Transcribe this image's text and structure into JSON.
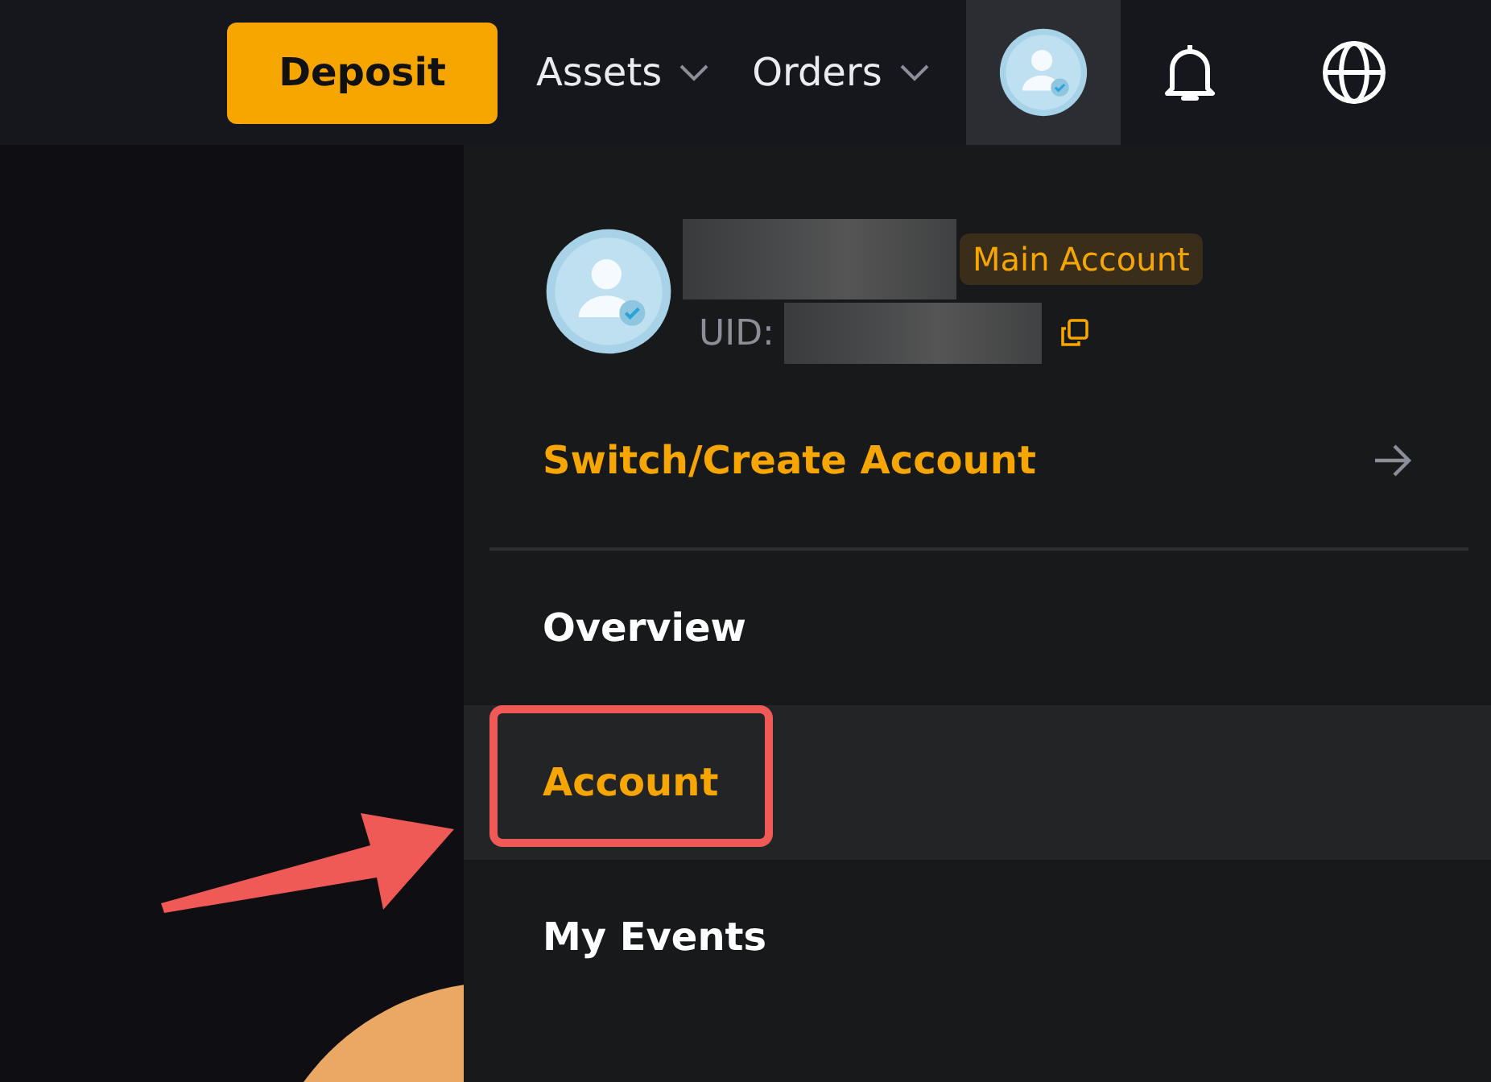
{
  "nav": {
    "deposit": "Deposit",
    "menus": [
      {
        "label": "Assets"
      },
      {
        "label": "Orders"
      }
    ],
    "avatar_active": true
  },
  "profile": {
    "badge": "Main Account",
    "uid_label": "UID:"
  },
  "switch_account": "Switch/Create Account",
  "menu": [
    {
      "label": "Overview",
      "selected": false
    },
    {
      "label": "Account",
      "selected": true
    },
    {
      "label": "My Events",
      "selected": false
    }
  ]
}
